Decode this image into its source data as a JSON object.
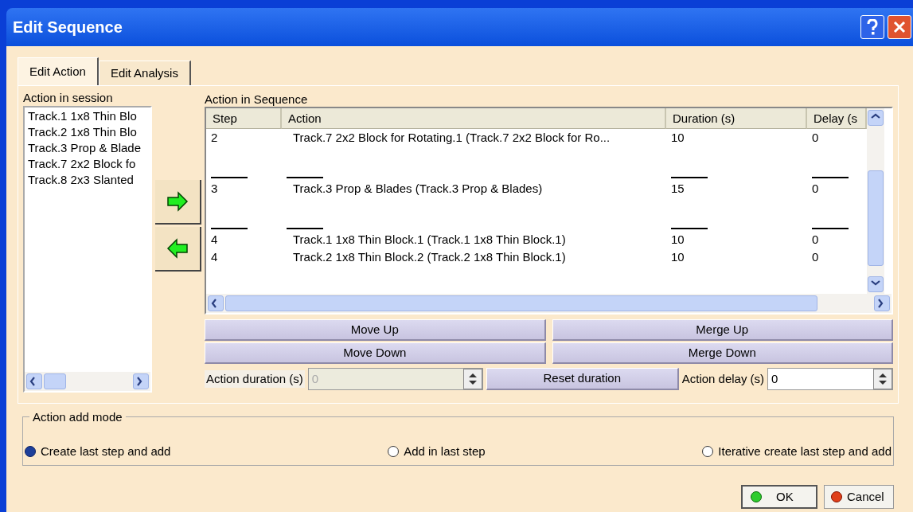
{
  "window": {
    "title": "Edit Sequence"
  },
  "tabs": [
    {
      "label": "Edit Action",
      "selected": true
    },
    {
      "label": "Edit Analysis",
      "selected": false
    }
  ],
  "session": {
    "label": "Action in session",
    "items": [
      "Track.1 1x8 Thin Blo",
      "Track.2 1x8 Thin Blo",
      "Track.3 Prop & Blade",
      "Track.7 2x2 Block fo",
      "Track.8 2x3 Slanted"
    ]
  },
  "sequence": {
    "label": "Action in Sequence",
    "columns": [
      "Step",
      "Action",
      "Duration (s)",
      "Delay (s"
    ],
    "rows": [
      {
        "kind": "item",
        "cells": [
          "2",
          "Track.7 2x2 Block for Rotating.1 (Track.7 2x2 Block for Ro...",
          "10",
          "0"
        ]
      },
      {
        "kind": "separator"
      },
      {
        "kind": "item",
        "cells": [
          "3",
          "Track.3 Prop & Blades (Track.3 Prop & Blades)",
          "15",
          "0"
        ]
      },
      {
        "kind": "separator"
      },
      {
        "kind": "item",
        "cells": [
          "4",
          "Track.1 1x8 Thin Block.1 (Track.1 1x8 Thin Block.1)",
          "10",
          "0"
        ]
      },
      {
        "kind": "item",
        "cells": [
          "4",
          "Track.2 1x8 Thin Block.2 (Track.2 1x8 Thin Block.1)",
          "10",
          "0"
        ]
      }
    ]
  },
  "buttons": {
    "move_up": "Move Up",
    "merge_up": "Merge Up",
    "move_down": "Move Down",
    "merge_down": "Merge Down",
    "reset": "Reset duration"
  },
  "action_duration": {
    "label": "Action duration (s)",
    "value": "0",
    "disabled": true
  },
  "action_delay": {
    "label": "Action delay (s)",
    "value": "0",
    "disabled": false
  },
  "add_mode": {
    "label": "Action add mode",
    "options": [
      {
        "label": "Create last step and add",
        "selected": true
      },
      {
        "label": "Add in last step",
        "selected": false
      },
      {
        "label": "Iterative create last step and add",
        "selected": false
      }
    ]
  },
  "footer": {
    "ok": "OK",
    "cancel": "Cancel"
  }
}
